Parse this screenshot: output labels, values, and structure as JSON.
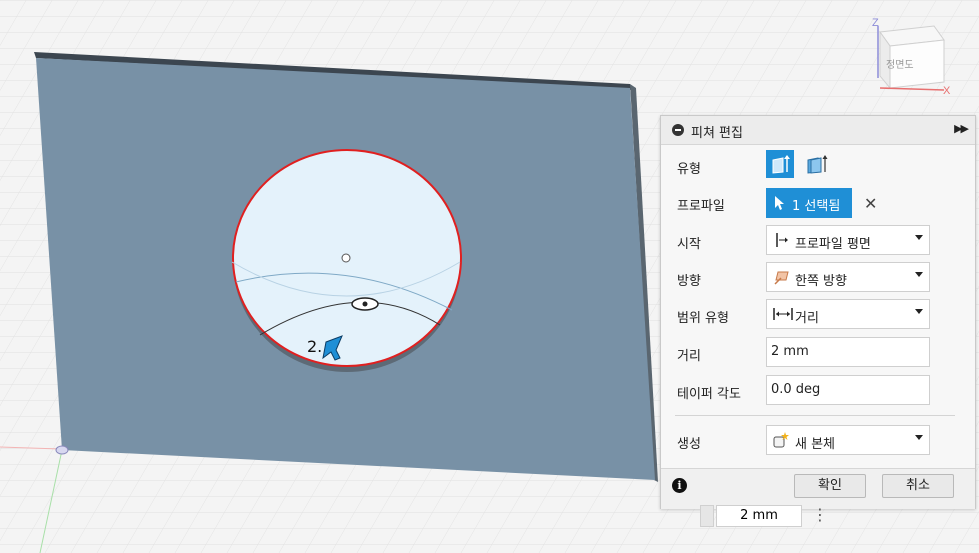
{
  "viewcube": {
    "face_label": "정면도",
    "axis_z": "Z",
    "axis_x": "X"
  },
  "canvas": {
    "drag_value": "2.",
    "distance_input": "2 mm"
  },
  "panel": {
    "title": "피쳐 편집",
    "rows": {
      "type_label": "유형",
      "profile_label": "프로파일",
      "profile_button": "1 선택됨",
      "start_label": "시작",
      "start_value": "프로파일 평면",
      "direction_label": "방향",
      "direction_value": "한쪽 방향",
      "extent_label": "범위 유형",
      "extent_value": "거리",
      "distance_label": "거리",
      "distance_value": "2 mm",
      "taper_label": "테이퍼 각도",
      "taper_value": "0.0 deg",
      "operation_label": "생성",
      "operation_value": "새 본체"
    },
    "ok_label": "확인",
    "cancel_label": "취소"
  },
  "colors": {
    "plate": "#7891a6",
    "accent_blue": "#1f8fd6",
    "profile_red": "#e02020"
  }
}
